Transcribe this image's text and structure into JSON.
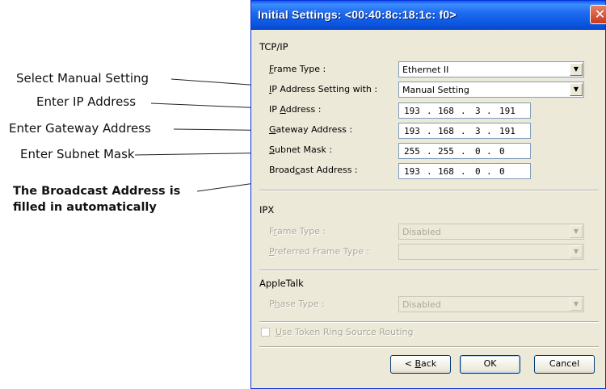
{
  "callouts": {
    "select_manual": "Select Manual Setting",
    "enter_ip": "Enter IP Address",
    "enter_gateway": "Enter Gateway Address",
    "enter_subnet": "Enter Subnet Mask",
    "broadcast_line1": "The Broadcast Address is",
    "broadcast_line2": "filled in automatically"
  },
  "dialog": {
    "title": "Initial Settings:  <00:40:8c:18:1c: f0>",
    "close_glyph": "✕",
    "tcpip": {
      "heading": "TCP/IP",
      "frame_type": {
        "label_u": "F",
        "label_rest": "rame Type :",
        "value": "Ethernet II"
      },
      "ip_setting": {
        "label_u": "I",
        "label_rest": "P Address Setting with :",
        "value": "Manual Setting"
      },
      "ip_address": {
        "label_pre": "IP ",
        "label_u": "A",
        "label_rest": "ddress :",
        "octets": [
          "193",
          "168",
          "3",
          "191"
        ]
      },
      "gateway": {
        "label_u": "G",
        "label_rest": "ateway Address :",
        "octets": [
          "193",
          "168",
          "3",
          "191"
        ]
      },
      "subnet": {
        "label_u": "S",
        "label_rest": "ubnet Mask :",
        "octets": [
          "255",
          "255",
          "0",
          "0"
        ]
      },
      "broadcast": {
        "label_pre": "Broad",
        "label_u": "c",
        "label_rest": "ast Address :",
        "octets": [
          "193",
          "168",
          "0",
          "0"
        ]
      }
    },
    "ipx": {
      "heading": "IPX",
      "frame_type": {
        "label_pre": "F",
        "label_u": "r",
        "label_rest": "ame Type :",
        "value": "Disabled"
      },
      "preferred_frame_type": {
        "label_u": "P",
        "label_rest": "referred Frame Type :",
        "value": ""
      }
    },
    "appletalk": {
      "heading": "AppleTalk",
      "phase_type": {
        "label_pre": "P",
        "label_u": "h",
        "label_rest": "ase Type :",
        "value": "Disabled"
      }
    },
    "token_ring": {
      "label_u": "U",
      "label_rest": "se Token Ring Source Routing",
      "checked": false
    },
    "buttons": {
      "back_pre": "< ",
      "back_u": "B",
      "back_rest": "ack",
      "ok": "OK",
      "cancel": "Cancel"
    },
    "dot": "."
  }
}
